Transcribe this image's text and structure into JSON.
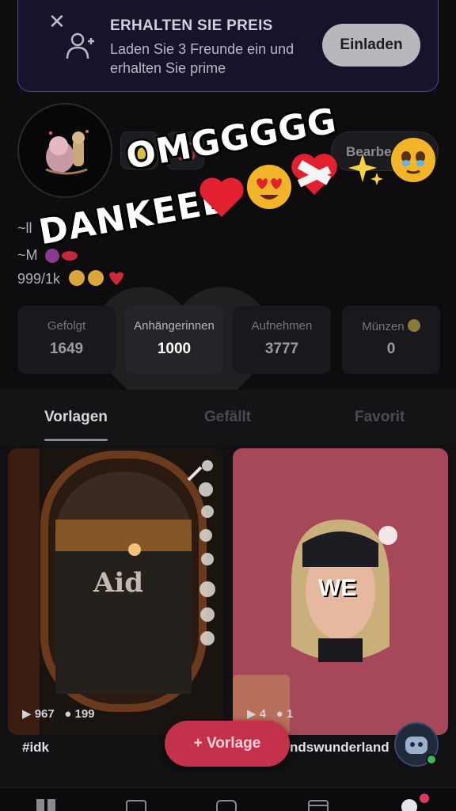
{
  "banner": {
    "title": "ERHALTEN SIE PREIS",
    "subtitle": "Laden Sie 3 Freunde ein und erhalten Sie prime",
    "invite_label": "Einladen"
  },
  "profile": {
    "edit_label": "Bearbe",
    "bio_line1": "~ll",
    "bio_line2": "~M",
    "bio_line3": "999/1k"
  },
  "sticker": {
    "line1": "OMGGGGG",
    "line2": "DANKEEE"
  },
  "stats": [
    {
      "label": "Gefolgt",
      "value": "1649"
    },
    {
      "label": "Anhängerinnen",
      "value": "1000"
    },
    {
      "label": "Aufnehmen",
      "value": "3777"
    },
    {
      "label": "Münzen",
      "value": "0"
    }
  ],
  "tabs": [
    {
      "label": "Vorlagen"
    },
    {
      "label": "Gefällt"
    },
    {
      "label": "Favorit"
    }
  ],
  "cards": [
    {
      "title": "#idk",
      "plays": "967",
      "comments": "199",
      "overlay_text": "Aid"
    },
    {
      "title": "ndswunderland",
      "plays": "4",
      "comments": "1",
      "overlay_text": "WE"
    }
  ],
  "fab": {
    "label": "+ Vorlage"
  },
  "colors": {
    "accent": "#c4314a",
    "banner_border": "#4a4a9a",
    "online": "#3ab65a"
  }
}
